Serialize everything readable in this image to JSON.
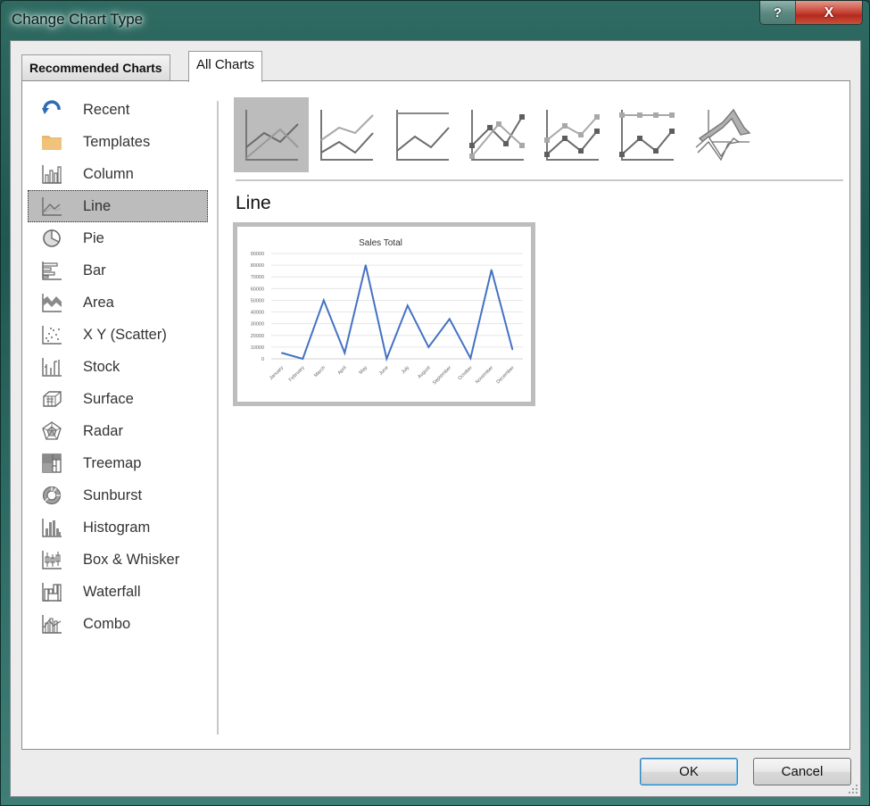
{
  "window": {
    "title": "Change Chart Type",
    "help_label": "?",
    "close_label": "X"
  },
  "tabs": [
    {
      "label": "Recommended Charts",
      "active": false
    },
    {
      "label": "All Charts",
      "active": true
    }
  ],
  "sidebar": {
    "selected": "Line",
    "items": [
      {
        "label": "Recent",
        "icon": "recent-icon"
      },
      {
        "label": "Templates",
        "icon": "folder-icon"
      },
      {
        "label": "Column",
        "icon": "column-chart-icon"
      },
      {
        "label": "Line",
        "icon": "line-chart-icon"
      },
      {
        "label": "Pie",
        "icon": "pie-chart-icon"
      },
      {
        "label": "Bar",
        "icon": "bar-chart-icon"
      },
      {
        "label": "Area",
        "icon": "area-chart-icon"
      },
      {
        "label": "X Y (Scatter)",
        "icon": "scatter-chart-icon"
      },
      {
        "label": "Stock",
        "icon": "stock-chart-icon"
      },
      {
        "label": "Surface",
        "icon": "surface-chart-icon"
      },
      {
        "label": "Radar",
        "icon": "radar-chart-icon"
      },
      {
        "label": "Treemap",
        "icon": "treemap-chart-icon"
      },
      {
        "label": "Sunburst",
        "icon": "sunburst-chart-icon"
      },
      {
        "label": "Histogram",
        "icon": "histogram-chart-icon"
      },
      {
        "label": "Box & Whisker",
        "icon": "box-whisker-chart-icon"
      },
      {
        "label": "Waterfall",
        "icon": "waterfall-chart-icon"
      },
      {
        "label": "Combo",
        "icon": "combo-chart-icon"
      }
    ]
  },
  "subtypes": [
    {
      "name": "line",
      "icon": "line-subtype-icon",
      "selected": true
    },
    {
      "name": "stacked-line",
      "icon": "stacked-line-subtype-icon",
      "selected": false
    },
    {
      "name": "100-stacked-line",
      "icon": "100-stacked-line-subtype-icon",
      "selected": false
    },
    {
      "name": "line-with-markers",
      "icon": "line-markers-subtype-icon",
      "selected": false
    },
    {
      "name": "stacked-line-with-markers",
      "icon": "stacked-line-markers-subtype-icon",
      "selected": false
    },
    {
      "name": "100-stacked-line-with-markers",
      "icon": "100-stacked-line-markers-subtype-icon",
      "selected": false
    },
    {
      "name": "3d-line",
      "icon": "3d-line-subtype-icon",
      "selected": false
    }
  ],
  "preview": {
    "heading": "Line"
  },
  "chart_data": {
    "type": "line",
    "title": "Sales Total",
    "xlabel": "",
    "ylabel": "",
    "categories": [
      "January",
      "February",
      "March",
      "April",
      "May",
      "June",
      "July",
      "August",
      "September",
      "October",
      "November",
      "December"
    ],
    "series": [
      {
        "name": "Sales Total",
        "values": [
          5000,
          0,
          50000,
          5000,
          80000,
          0,
          45500,
          10000,
          34000,
          500,
          76000,
          8000
        ],
        "color": "#4472c4"
      }
    ],
    "ylim": [
      0,
      90000
    ],
    "yticks": [
      0,
      10000,
      20000,
      30000,
      40000,
      50000,
      60000,
      70000,
      80000,
      90000
    ],
    "grid": true,
    "legend": "none"
  },
  "buttons": {
    "ok": "OK",
    "cancel": "Cancel"
  },
  "colors": {
    "selection_bg": "#bcbcbc",
    "series_line": "#4472c4",
    "close_button": "#c9473a"
  }
}
